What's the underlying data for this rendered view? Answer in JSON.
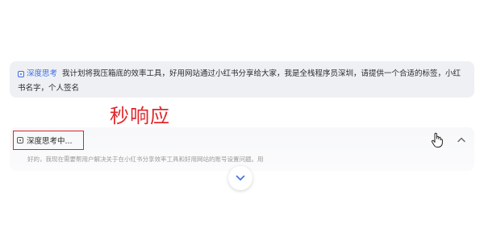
{
  "user_message": {
    "badge_label": "深度思考",
    "badge_icon": "deep-think-icon",
    "text": "我计划将我压箱底的效率工具，好用网站通过小红书分享给大家，我是全栈程序员深圳，请提供一个合适的标签，小红书名字，个人签名"
  },
  "annotation": {
    "text": "秒响应",
    "color": "#e0282d"
  },
  "thinking": {
    "status_label": "深度思考中...",
    "status_icon": "deep-think-icon",
    "preview_text": "好的，我现在需要帮用户解决关于在小红书分享效率工具和好用网站的账号设置问题。用",
    "toggle_icon": "chevron-up-icon"
  },
  "scroll_button": {
    "icon": "chevron-down-icon"
  },
  "colors": {
    "accent": "#3f6ee8",
    "highlight_box": "#d9252b"
  }
}
